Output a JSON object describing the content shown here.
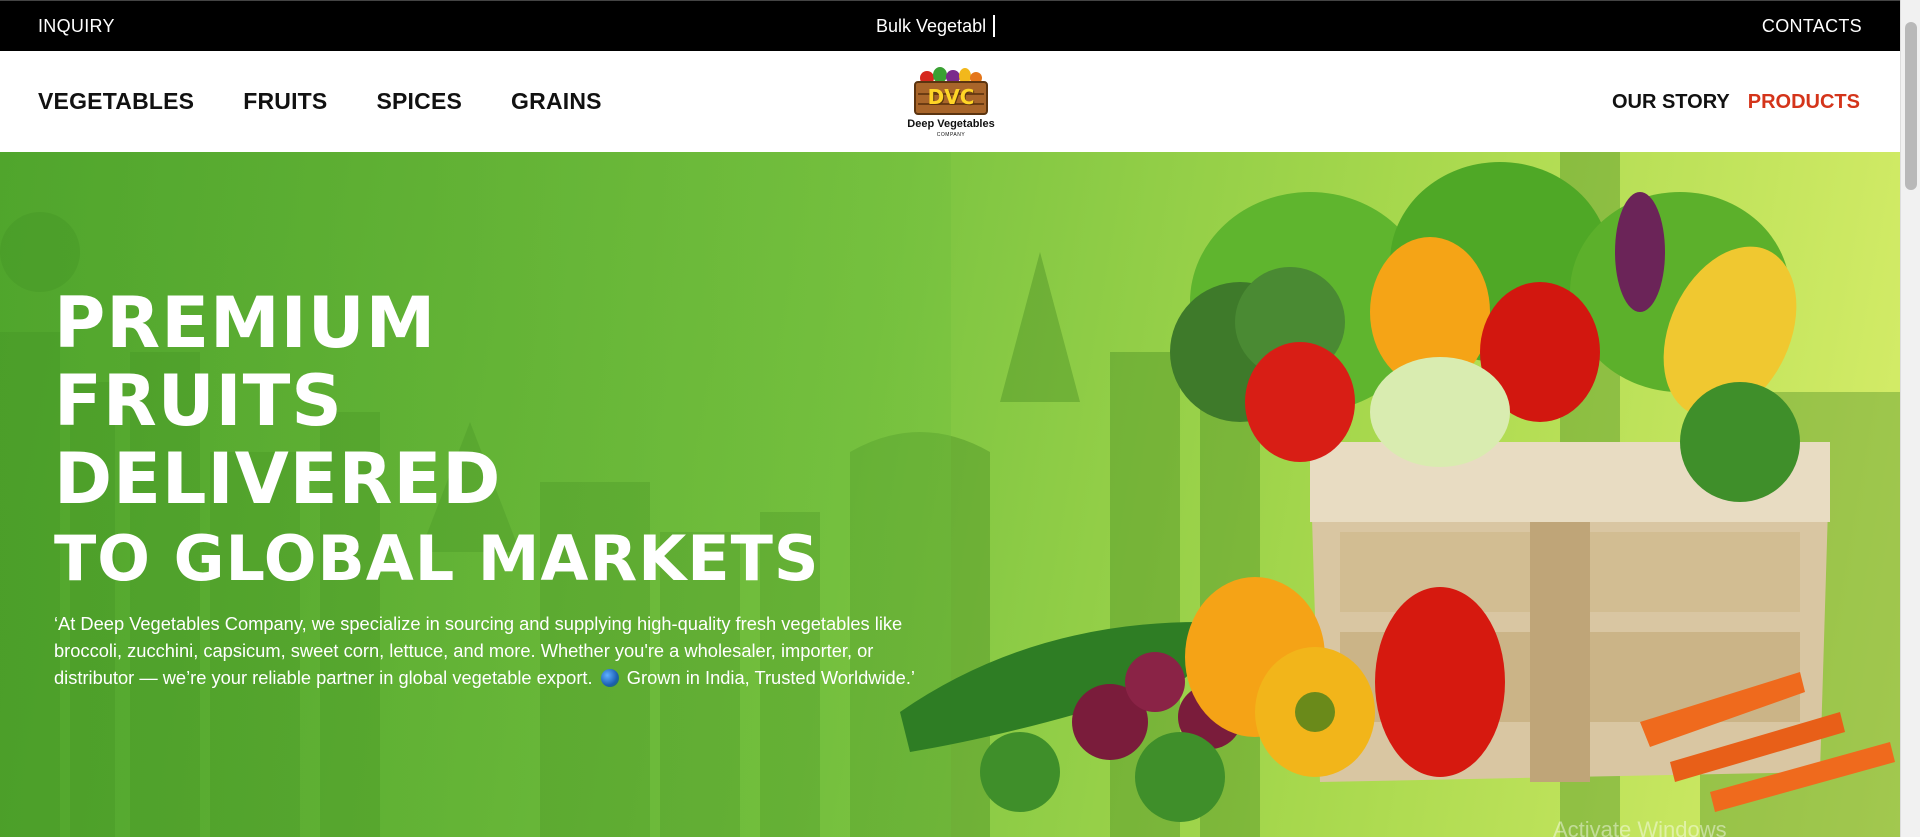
{
  "topbar": {
    "inquiry": "INQUIRY",
    "typing_text": "Bulk Vegetabl",
    "contacts": "CONTACTS"
  },
  "nav": {
    "menu": [
      "VEGETABLES",
      "FRUITS",
      "SPICES",
      "GRAINS"
    ],
    "right": [
      "OUR STORY",
      "PRODUCTS"
    ],
    "active_color": "#d4341a"
  },
  "logo": {
    "mark": "DVC",
    "name": "Deep Vegetables",
    "sub": "COMPANY"
  },
  "hero": {
    "line1": "PREMIUM",
    "line2": "FRUITS",
    "line3": "DELIVERED",
    "line4": "TO GLOBAL MARKETS",
    "para_part1": "‘At Deep Vegetables Company, we specialize in sourcing and supplying high-quality fresh vegetables like broccoli, zucchini, capsicum, sweet corn, lettuce, and more. Whether you're a wholesaler, importer, or distributor — we’re your reliable partner in global vegetable export.",
    "para_part2": "Grown in India, Trusted Worldwide.’",
    "globe_icon": "globe-icon"
  },
  "watermark": "Activate Windows",
  "colors": {
    "topbar": "#000000",
    "hero_green": "#6cbf3a",
    "hero_lime": "#d9ee6a"
  }
}
